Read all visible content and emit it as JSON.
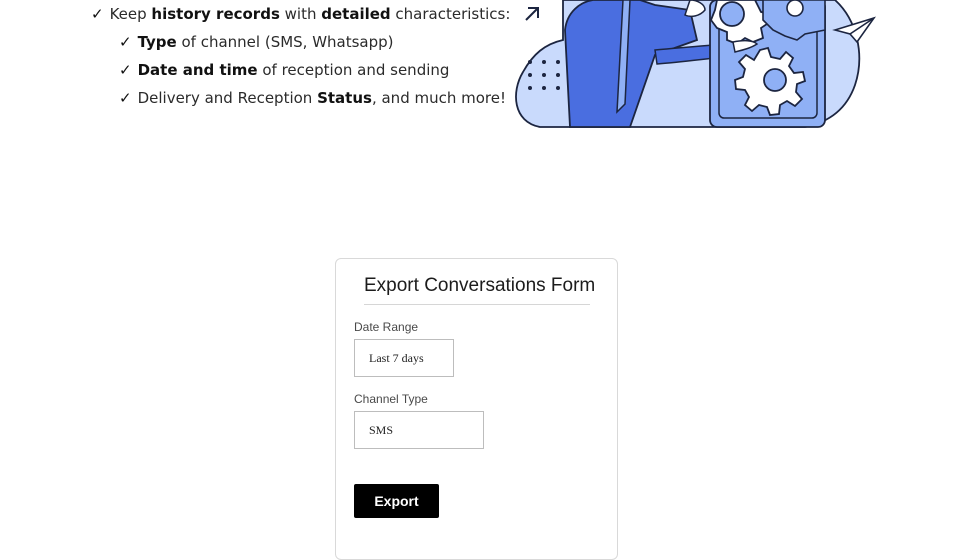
{
  "features": [
    {
      "check": "✓",
      "parts": [
        {
          "t": "Keep ",
          "b": false
        },
        {
          "t": "history records",
          "b": true
        },
        {
          "t": " with ",
          "b": false
        },
        {
          "t": "detailed",
          "b": true
        },
        {
          "t": " characteristics:",
          "b": false
        }
      ]
    },
    {
      "check": "✓",
      "parts": [
        {
          "t": "Type",
          "b": true
        },
        {
          "t": " of channel (SMS, Whatsapp)",
          "b": false
        }
      ]
    },
    {
      "check": "✓",
      "parts": [
        {
          "t": "Date and time",
          "b": true
        },
        {
          "t": " of reception and sending",
          "b": false
        }
      ]
    },
    {
      "check": "✓",
      "parts": [
        {
          "t": "Delivery and Reception ",
          "b": false
        },
        {
          "t": "Status",
          "b": true
        },
        {
          "t": ", and much more!",
          "b": false
        }
      ]
    }
  ],
  "form": {
    "title": "Export Conversations Form",
    "date_range_label": "Date Range",
    "date_range_value": "Last 7 days",
    "channel_type_label": "Channel Type",
    "channel_type_value": "SMS",
    "export_label": "Export"
  },
  "colors": {
    "accent_blue": "#4a6ee0",
    "light_blue": "#c9dafc",
    "mid_blue": "#8fb0f5",
    "button_bg": "#000000"
  }
}
